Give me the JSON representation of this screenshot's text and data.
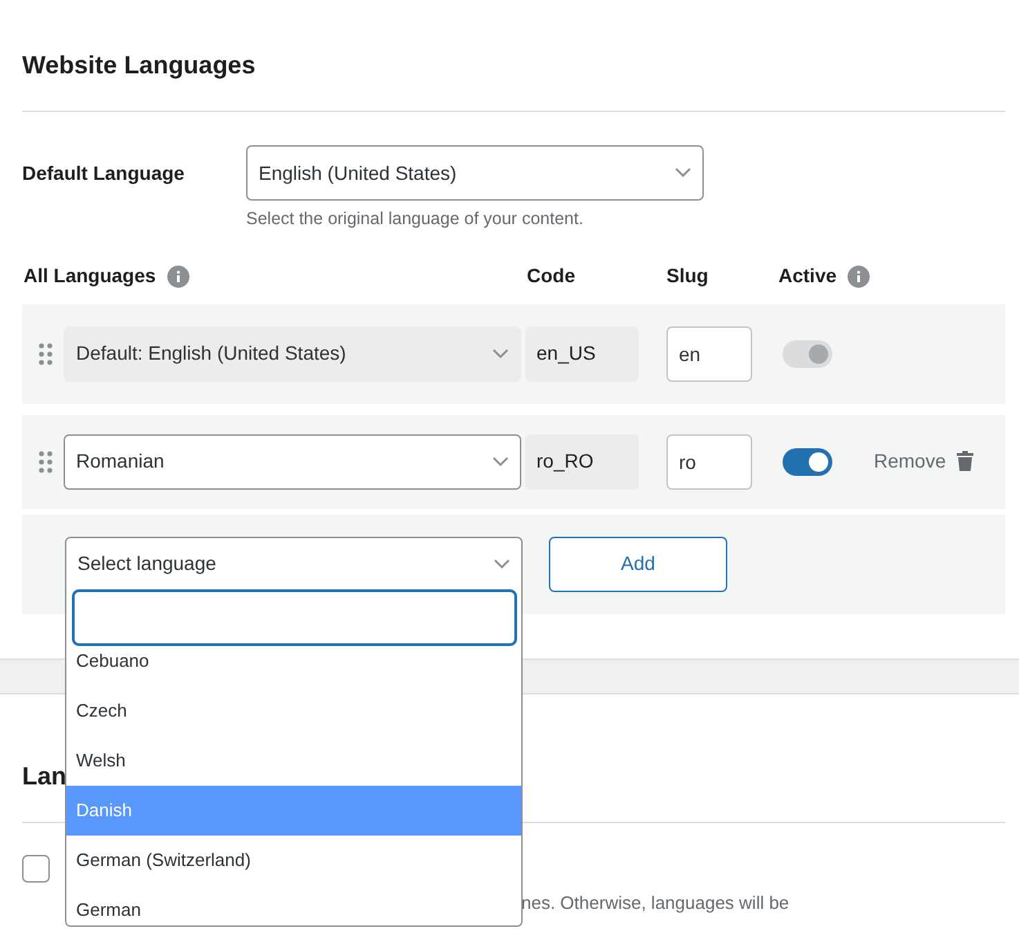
{
  "section_title": "Website Languages",
  "default_language": {
    "label": "Default Language",
    "value": "English (United States)",
    "help": "Select the original language of your content."
  },
  "table": {
    "columns": [
      {
        "label": "All Languages",
        "info": true
      },
      {
        "label": "Code",
        "info": false
      },
      {
        "label": "Slug",
        "info": false
      },
      {
        "label": "Active",
        "info": true
      }
    ],
    "rows": [
      {
        "language": "Default: English (United States)",
        "disabled": true,
        "code": "en_US",
        "slug": "en",
        "active": true
      },
      {
        "language": "Romanian",
        "disabled": false,
        "code": "ro_RO",
        "slug": "ro",
        "active": true,
        "remove": "Remove"
      }
    ]
  },
  "add_row": {
    "placeholder": "Select language",
    "button": "Add"
  },
  "dropdown": {
    "expanded": true,
    "options": [
      {
        "label": "Cebuano",
        "selected": false
      },
      {
        "label": "Czech",
        "selected": false
      },
      {
        "label": "Welsh",
        "selected": false
      },
      {
        "label": "Danish",
        "selected": true
      },
      {
        "label": "German (Switzerland)",
        "selected": false
      },
      {
        "label": "German",
        "selected": false
      }
    ]
  },
  "second_section": {
    "title": "Lan",
    "checkbox": {
      "checked": false
    },
    "description": "nes. Otherwise, languages will be"
  }
}
